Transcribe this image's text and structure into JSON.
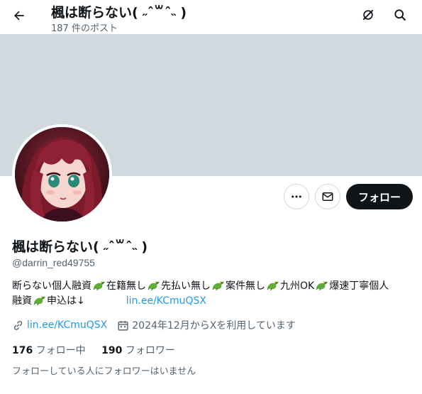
{
  "header": {
    "title": "楓は断らない( ˶ˆ꒳ˆ˵ )",
    "post_count": "187 件のポスト"
  },
  "profile": {
    "display_name": "楓は断らない( ˶ˆ꒳ˆ˵ )",
    "handle": "@darrin_red49755",
    "bio": {
      "seg1": "断らない個人融資",
      "seg2": "在籍無し",
      "seg3": "先払い無し",
      "seg4": "案件無し",
      "seg5": "九州OK",
      "seg6": "爆速丁寧個人",
      "seg7": "融資",
      "seg8": "申込は↓",
      "link": "lin.ee/KCmuQSX",
      "emoji_icon": "dragon-emoji"
    },
    "website": "lin.ee/KCmuQSX",
    "joined": "2024年12月からXを利用しています",
    "following_count": "176",
    "following_label": "フォロー中",
    "followers_count": "190",
    "followers_label": "フォロワー",
    "mutual_note": "フォローしている人にフォロワーはいません"
  },
  "actions": {
    "follow_label": "フォロー",
    "more_icon": "more-icon",
    "message_icon": "mail-icon",
    "grok_icon": "grok-icon",
    "search_icon": "search-icon",
    "back_icon": "back-arrow-icon"
  },
  "colors": {
    "banner": "#cfd9de",
    "link": "#1d9bf0",
    "follow_button": "#0f1419",
    "secondary_text": "#536471"
  }
}
